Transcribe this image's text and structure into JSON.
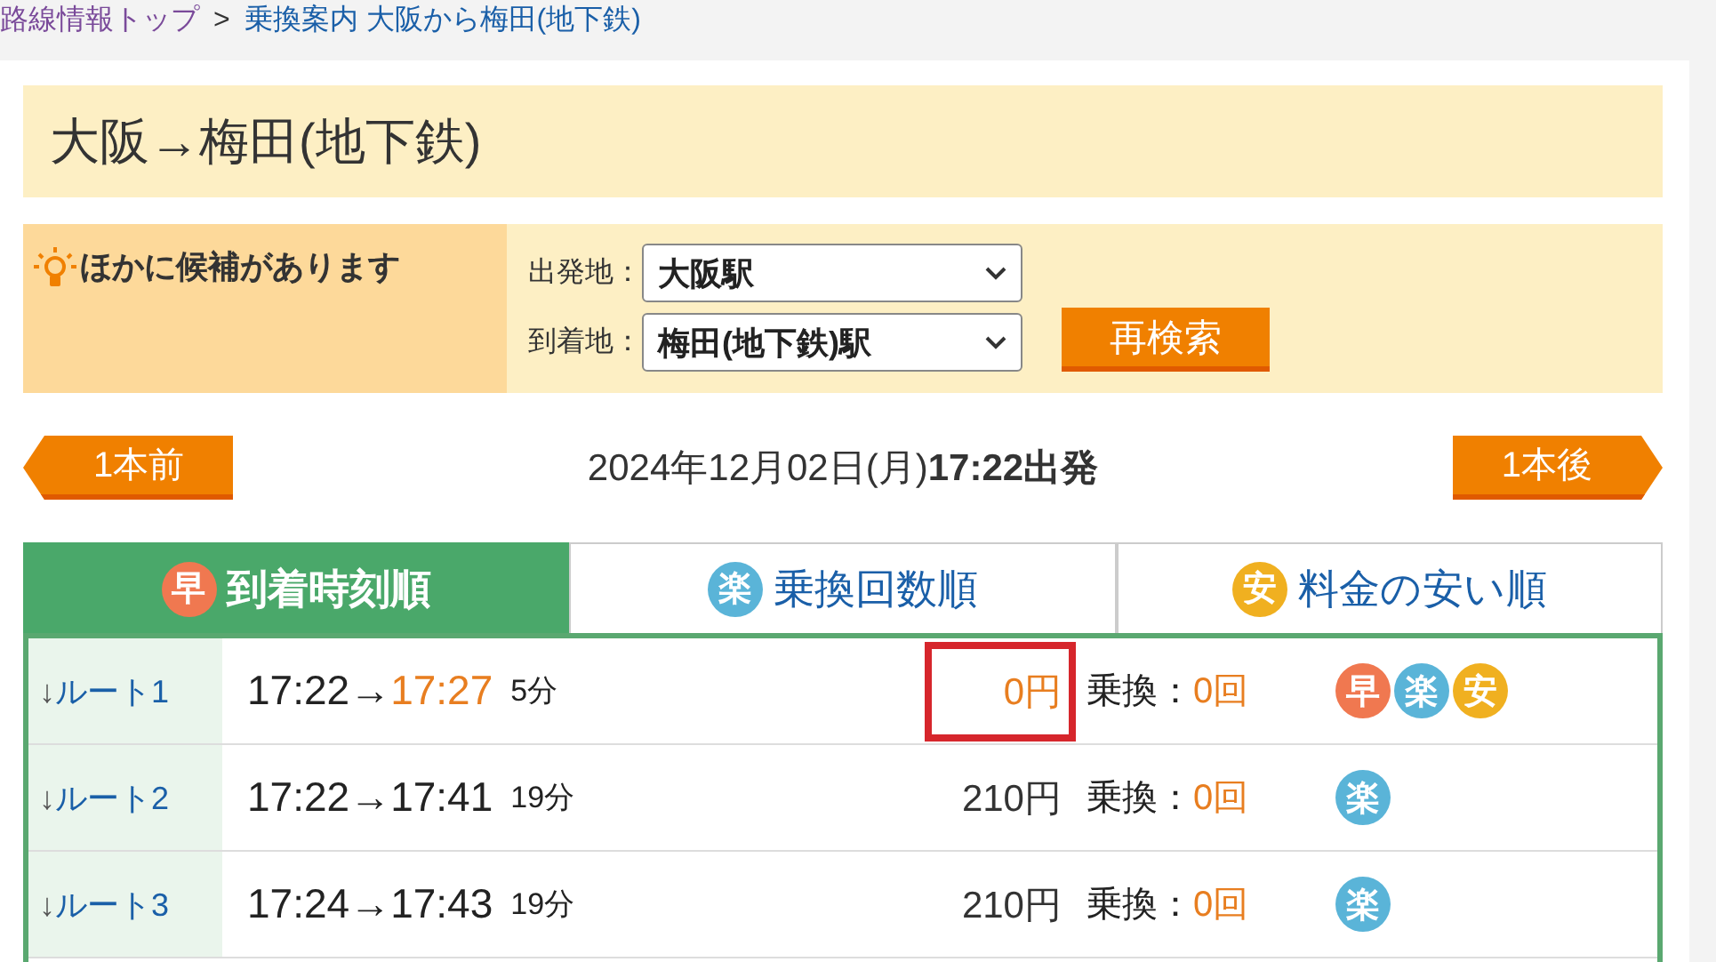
{
  "breadcrumb": {
    "items": [
      {
        "label": "路線情報トップ",
        "visited": true
      },
      {
        "label": "乗換案内 大阪から梅田(地下鉄)",
        "visited": false
      }
    ],
    "separator": ">"
  },
  "title": "大阪→梅田(地下鉄)",
  "candidates": {
    "notice": "ほかに候補があります",
    "fields": [
      {
        "label": "出発地：",
        "value": "大阪駅"
      },
      {
        "label": "到着地：",
        "value": "梅田(地下鉄)駅"
      }
    ],
    "button": "再検索"
  },
  "nav": {
    "prev": "1本前",
    "date": "2024年12月02日(月)",
    "time": "17:22出発",
    "next": "1本後"
  },
  "tabs": [
    {
      "badge": "早",
      "color": "#f07850",
      "label": "到着時刻順",
      "selected": true
    },
    {
      "badge": "楽",
      "color": "#5ab4d8",
      "label": "乗換回数順",
      "selected": false
    },
    {
      "badge": "安",
      "color": "#f0b020",
      "label": "料金の安い順",
      "selected": false
    }
  ],
  "routes": [
    {
      "arrow": "↓",
      "route": "ルート1",
      "depart": "17:22",
      "to": "→",
      "arrive": "17:27",
      "arrive_highlight": true,
      "duration": "5分",
      "fare": "0円",
      "fare_highlight": true,
      "marked": true,
      "transfer_label": "乗換：",
      "transfers": "0回",
      "badges": [
        {
          "label": "早",
          "color": "#f07850"
        },
        {
          "label": "楽",
          "color": "#5ab4d8"
        },
        {
          "label": "安",
          "color": "#f0b020"
        }
      ]
    },
    {
      "arrow": "↓",
      "route": "ルート2",
      "depart": "17:22",
      "to": "→",
      "arrive": "17:41",
      "arrive_highlight": false,
      "duration": "19分",
      "fare": "210円",
      "fare_highlight": false,
      "marked": false,
      "transfer_label": "乗換：",
      "transfers": "0回",
      "badges": [
        {
          "label": "楽",
          "color": "#5ab4d8"
        }
      ]
    },
    {
      "arrow": "↓",
      "route": "ルート3",
      "depart": "17:24",
      "to": "→",
      "arrive": "17:43",
      "arrive_highlight": false,
      "duration": "19分",
      "fare": "210円",
      "fare_highlight": false,
      "marked": false,
      "transfer_label": "乗換：",
      "transfers": "0回",
      "badges": [
        {
          "label": "楽",
          "color": "#5ab4d8"
        }
      ]
    }
  ]
}
